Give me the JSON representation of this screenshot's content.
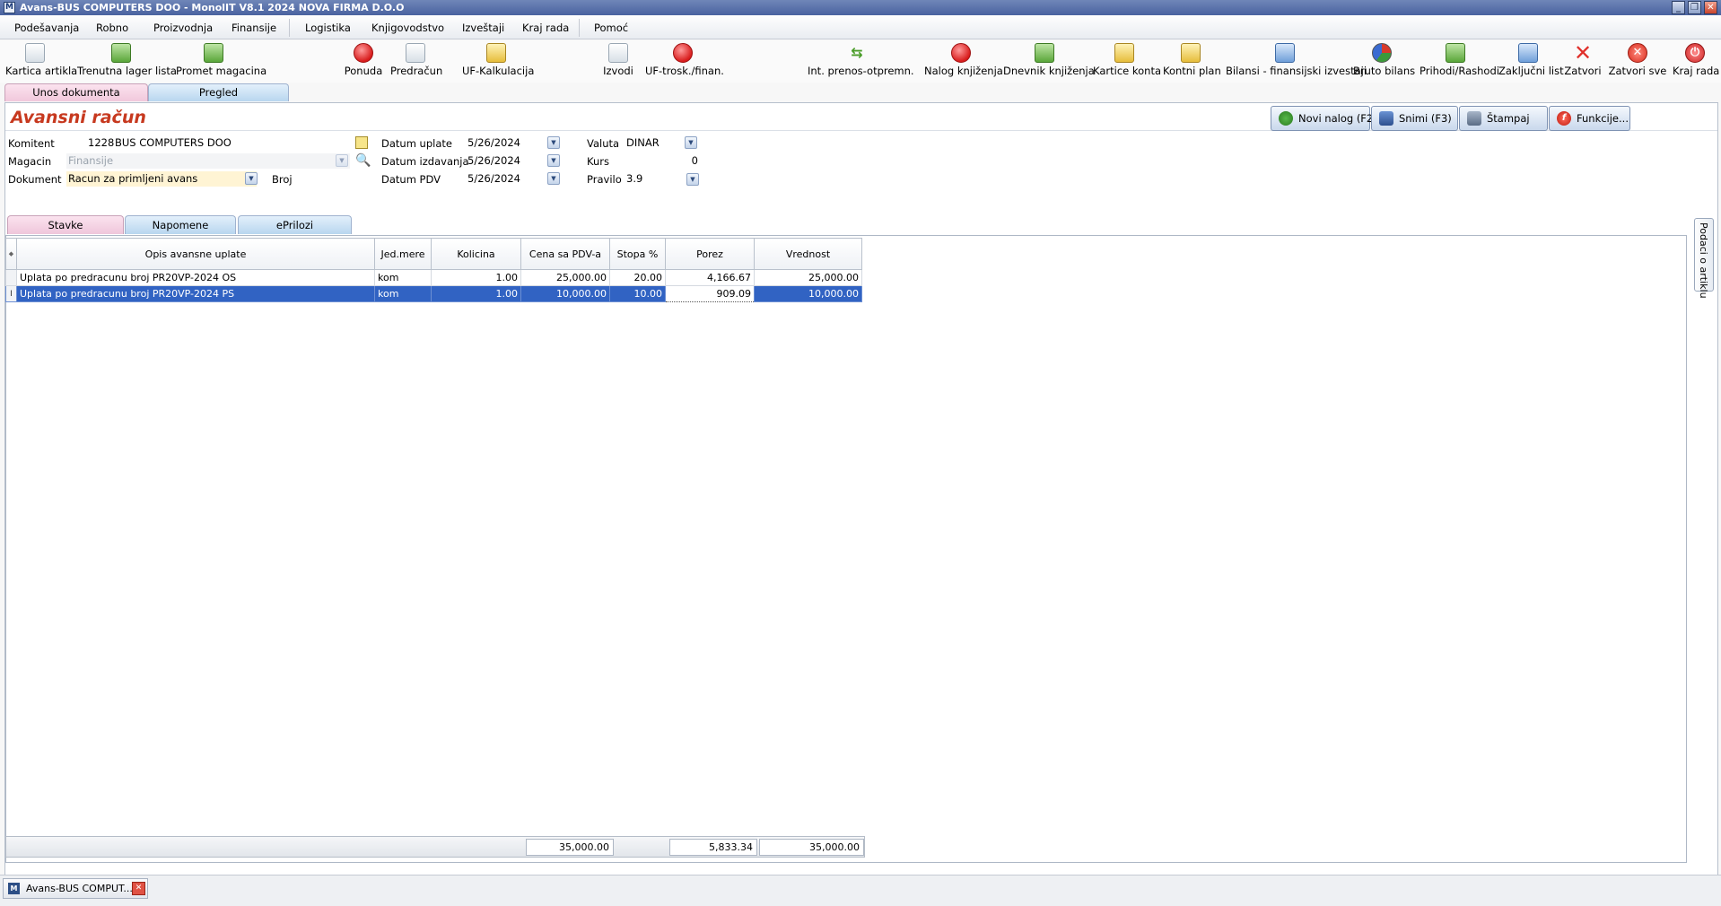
{
  "window": {
    "title": "Avans-BUS COMPUTERS DOO - MonolIT V8.1 2024 NOVA FIRMA D.O.O"
  },
  "menu": [
    "Podešavanja",
    "Robno",
    "Proizvodnja",
    "Finansije",
    "Logistika",
    "Knjigovodstvo",
    "Izveštaji",
    "Kraj rada",
    "Pomoć"
  ],
  "toolbar": [
    {
      "label": "Kartica artikla",
      "icon": "item-card-icon"
    },
    {
      "label": "Trenutna lager lista",
      "icon": "stock-list-icon"
    },
    {
      "label": "Promet magacina",
      "icon": "warehouse-turnover-icon"
    },
    {
      "label": "Ponuda",
      "icon": "offer-icon"
    },
    {
      "label": "Predračun",
      "icon": "proforma-icon"
    },
    {
      "label": "UF-Kalkulacija",
      "icon": "calculation-icon"
    },
    {
      "label": "Izvodi",
      "icon": "statements-icon"
    },
    {
      "label": "UF-trosk./finan.",
      "icon": "costs-icon"
    },
    {
      "label": "Int. prenos-otpremn.",
      "icon": "transfer-icon"
    },
    {
      "label": "Nalog knjiženja",
      "icon": "posting-order-icon"
    },
    {
      "label": "Dnevnik knjiženja",
      "icon": "journal-icon"
    },
    {
      "label": "Kartice konta",
      "icon": "account-cards-icon"
    },
    {
      "label": "Kontni plan",
      "icon": "chart-of-accounts-icon"
    },
    {
      "label": "Bilansi - finansijski izvestaji",
      "icon": "balance-reports-icon"
    },
    {
      "label": "Bruto bilans",
      "icon": "gross-balance-icon"
    },
    {
      "label": "Prihodi/Rashodi",
      "icon": "income-expense-icon"
    },
    {
      "label": "Zaključni list",
      "icon": "closing-sheet-icon"
    },
    {
      "label": "Zatvori",
      "icon": "close-icon"
    },
    {
      "label": "Zatvori sve",
      "icon": "close-all-icon"
    },
    {
      "label": "Kraj rada",
      "icon": "power-icon"
    }
  ],
  "doc_tabs": [
    "Unos dokumenta",
    "Pregled"
  ],
  "page_title": "Avansni račun",
  "actions": {
    "new": "Novi nalog (F2)",
    "save": "Snimi (F3)",
    "print": "Štampaj",
    "functions": "Funkcije..."
  },
  "form": {
    "komitent_label": "Komitent",
    "komitent_code": "1228",
    "komitent_name": "BUS COMPUTERS DOO",
    "magacin_label": "Magacin",
    "magacin_value": "Finansije",
    "dokument_label": "Dokument",
    "dokument_value": "Racun za primljeni avans",
    "broj_label": "Broj",
    "datum_uplate_label": "Datum uplate",
    "datum_uplate": "5/26/2024",
    "datum_izdavanja_label": "Datum izdavanja",
    "datum_izdavanja": "5/26/2024",
    "datum_pdv_label": "Datum PDV",
    "datum_pdv": "5/26/2024",
    "valuta_label": "Valuta",
    "valuta": "DINAR",
    "kurs_label": "Kurs",
    "kurs": "0",
    "pravilo_label": "Pravilo",
    "pravilo": "3.9"
  },
  "sub_tabs": [
    "Stavke",
    "Napomene",
    "ePrilozi"
  ],
  "side_tab": "Podaci o artiklu",
  "grid": {
    "columns": [
      "Opis avansne uplate",
      "Jed.mere",
      "Kolicina",
      "Cena sa PDV-a",
      "Stopa %",
      "Porez",
      "Vrednost"
    ],
    "rows": [
      [
        "Uplata po predracunu broj PR20VP-2024 OS",
        "kom",
        "1.00",
        "25,000.00",
        "20.00",
        "4,166.67",
        "25,000.00"
      ],
      [
        "Uplata po predracunu broj PR20VP-2024 PS",
        "kom",
        "1.00",
        "10,000.00",
        "10.00",
        "909.09",
        "10,000.00"
      ]
    ],
    "totals": {
      "cena": "35,000.00",
      "porez": "5,833.34",
      "vrednost": "35,000.00"
    }
  },
  "taskbar": {
    "label": "Avans-BUS COMPUT..."
  }
}
